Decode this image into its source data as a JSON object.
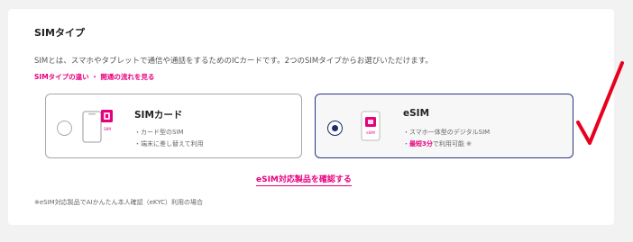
{
  "section": {
    "title": "SIMタイプ",
    "description": "SIMとは、スマホやタブレットで通信や通話をするためのICカードです。2つのSIMタイプからお選びいただけます。",
    "link": "SIMタイプの違い ・ 開通の流れを見る"
  },
  "options": {
    "sim_card": {
      "label": "SIMカード",
      "icon_text": "SIM",
      "bullets": [
        "・カード型のSIM",
        "・端末に差し替えて利用"
      ],
      "selected": false
    },
    "esim": {
      "label": "eSIM",
      "icon_text": "eSIM",
      "bullet1": "・スマホ一体型のデジタルSIM",
      "bullet2_prefix": "・",
      "bullet2_emphasis": "最短3分",
      "bullet2_suffix": "で利用可能 ※",
      "selected": true
    }
  },
  "confirm_link": "eSIM対応製品を確認する",
  "footnote": "※eSIM対応製品でAIかんたん本人確認（eKYC）利用の場合",
  "colors": {
    "accent_pink": "#e6007e",
    "selected_border": "#2b3580",
    "annotation_check": "#e8001c"
  },
  "icons": [
    "sim-card-icon",
    "esim-chip-icon",
    "checkmark-annotation-icon"
  ]
}
